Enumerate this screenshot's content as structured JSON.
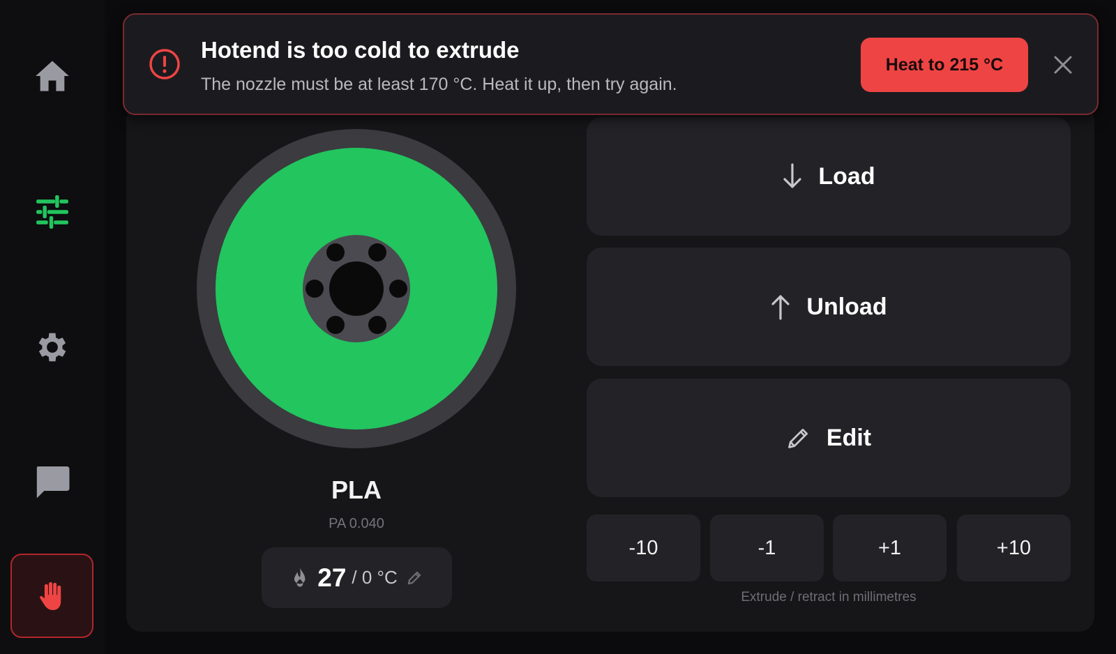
{
  "sidebar": {
    "items": [
      {
        "name": "home",
        "icon": "home-icon"
      },
      {
        "name": "tune",
        "icon": "sliders-icon",
        "active": true
      },
      {
        "name": "settings",
        "icon": "gear-icon"
      },
      {
        "name": "messages",
        "icon": "chat-icon"
      },
      {
        "name": "emergency-stop",
        "icon": "hand-stop-icon"
      }
    ],
    "active_color": "#22c55e",
    "stop_color": "#ef4444"
  },
  "alert": {
    "title": "Hotend is too cold to extrude",
    "message": "The nozzle must be at least 170 °C. Heat it up, then try again.",
    "action_label": "Heat to 215 °C",
    "icon": "alert-circle-icon",
    "close_icon": "close-icon",
    "color": "#ef4444"
  },
  "filament": {
    "material": "PLA",
    "pressure_advance": "PA 0.040",
    "color": "#22c55e",
    "temperature": {
      "current": "27",
      "target": "/ 0 °C",
      "icon": "flame-icon",
      "edit_icon": "pencil-icon"
    }
  },
  "actions": {
    "load_label": "Load",
    "unload_label": "Unload",
    "edit_label": "Edit"
  },
  "steps": {
    "values": [
      "-10",
      "-1",
      "+1",
      "+10"
    ],
    "caption": "Extrude / retract in millimetres"
  }
}
